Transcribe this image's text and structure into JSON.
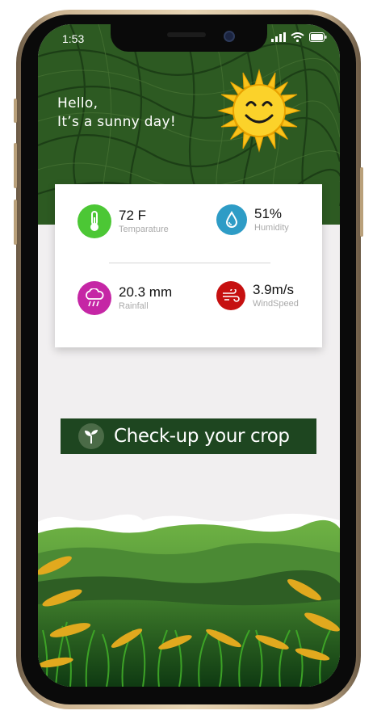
{
  "status_bar": {
    "time": "1:53"
  },
  "greeting": {
    "line1": "Hello,",
    "line2": "It’s a sunny day!"
  },
  "weather": {
    "temperature": {
      "value": "72 F",
      "label": "Temparature",
      "color": "#4cc735"
    },
    "humidity": {
      "value": "51%",
      "label": "Humidity",
      "color": "#2e9cc6"
    },
    "rainfall": {
      "value": "20.3 mm",
      "label": "Rainfall",
      "color": "#c526a5"
    },
    "windspeed": {
      "value": "3.9m/s",
      "label": "WindSpeed",
      "color": "#c61010"
    }
  },
  "cta": {
    "label": "Check-up your crop",
    "color": "#1e4620"
  },
  "colors": {
    "field_green": "#2d5a22",
    "sun": "#f9c21b",
    "background": "#f1eff0"
  }
}
